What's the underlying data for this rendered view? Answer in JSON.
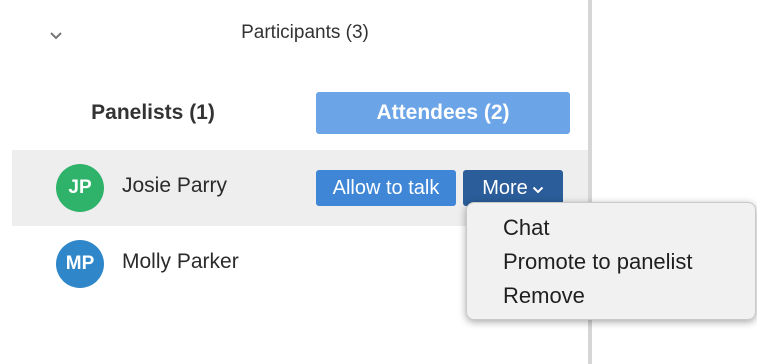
{
  "header": {
    "title": "Participants (3)",
    "collapse_icon": "chevron-down-icon"
  },
  "tabs": [
    {
      "label": "Panelists (1)",
      "active": false
    },
    {
      "label": "Attendees (2)",
      "active": true
    }
  ],
  "participants": [
    {
      "initials": "JP",
      "name": "Josie Parry",
      "avatar_color": "#2fb36b"
    },
    {
      "initials": "MP",
      "name": "Molly Parker",
      "avatar_color": "#2f87c9"
    }
  ],
  "row_actions": {
    "allow_label": "Allow to talk",
    "more_label": "More"
  },
  "menu": {
    "items": [
      "Chat",
      "Promote to panelist",
      "Remove"
    ]
  },
  "colors": {
    "accent": "#6ba4e7",
    "allow_button": "#3f87d6",
    "more_button": "#2a5d99",
    "row_highlight": "#eeeeee"
  }
}
